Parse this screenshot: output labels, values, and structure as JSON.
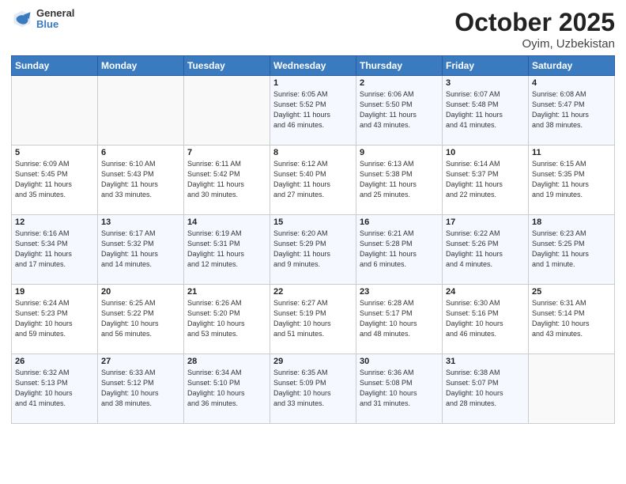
{
  "header": {
    "logo_general": "General",
    "logo_blue": "Blue",
    "month": "October 2025",
    "location": "Oyim, Uzbekistan"
  },
  "weekdays": [
    "Sunday",
    "Monday",
    "Tuesday",
    "Wednesday",
    "Thursday",
    "Friday",
    "Saturday"
  ],
  "weeks": [
    [
      {
        "day": "",
        "info": ""
      },
      {
        "day": "",
        "info": ""
      },
      {
        "day": "",
        "info": ""
      },
      {
        "day": "1",
        "info": "Sunrise: 6:05 AM\nSunset: 5:52 PM\nDaylight: 11 hours\nand 46 minutes."
      },
      {
        "day": "2",
        "info": "Sunrise: 6:06 AM\nSunset: 5:50 PM\nDaylight: 11 hours\nand 43 minutes."
      },
      {
        "day": "3",
        "info": "Sunrise: 6:07 AM\nSunset: 5:48 PM\nDaylight: 11 hours\nand 41 minutes."
      },
      {
        "day": "4",
        "info": "Sunrise: 6:08 AM\nSunset: 5:47 PM\nDaylight: 11 hours\nand 38 minutes."
      }
    ],
    [
      {
        "day": "5",
        "info": "Sunrise: 6:09 AM\nSunset: 5:45 PM\nDaylight: 11 hours\nand 35 minutes."
      },
      {
        "day": "6",
        "info": "Sunrise: 6:10 AM\nSunset: 5:43 PM\nDaylight: 11 hours\nand 33 minutes."
      },
      {
        "day": "7",
        "info": "Sunrise: 6:11 AM\nSunset: 5:42 PM\nDaylight: 11 hours\nand 30 minutes."
      },
      {
        "day": "8",
        "info": "Sunrise: 6:12 AM\nSunset: 5:40 PM\nDaylight: 11 hours\nand 27 minutes."
      },
      {
        "day": "9",
        "info": "Sunrise: 6:13 AM\nSunset: 5:38 PM\nDaylight: 11 hours\nand 25 minutes."
      },
      {
        "day": "10",
        "info": "Sunrise: 6:14 AM\nSunset: 5:37 PM\nDaylight: 11 hours\nand 22 minutes."
      },
      {
        "day": "11",
        "info": "Sunrise: 6:15 AM\nSunset: 5:35 PM\nDaylight: 11 hours\nand 19 minutes."
      }
    ],
    [
      {
        "day": "12",
        "info": "Sunrise: 6:16 AM\nSunset: 5:34 PM\nDaylight: 11 hours\nand 17 minutes."
      },
      {
        "day": "13",
        "info": "Sunrise: 6:17 AM\nSunset: 5:32 PM\nDaylight: 11 hours\nand 14 minutes."
      },
      {
        "day": "14",
        "info": "Sunrise: 6:19 AM\nSunset: 5:31 PM\nDaylight: 11 hours\nand 12 minutes."
      },
      {
        "day": "15",
        "info": "Sunrise: 6:20 AM\nSunset: 5:29 PM\nDaylight: 11 hours\nand 9 minutes."
      },
      {
        "day": "16",
        "info": "Sunrise: 6:21 AM\nSunset: 5:28 PM\nDaylight: 11 hours\nand 6 minutes."
      },
      {
        "day": "17",
        "info": "Sunrise: 6:22 AM\nSunset: 5:26 PM\nDaylight: 11 hours\nand 4 minutes."
      },
      {
        "day": "18",
        "info": "Sunrise: 6:23 AM\nSunset: 5:25 PM\nDaylight: 11 hours\nand 1 minute."
      }
    ],
    [
      {
        "day": "19",
        "info": "Sunrise: 6:24 AM\nSunset: 5:23 PM\nDaylight: 10 hours\nand 59 minutes."
      },
      {
        "day": "20",
        "info": "Sunrise: 6:25 AM\nSunset: 5:22 PM\nDaylight: 10 hours\nand 56 minutes."
      },
      {
        "day": "21",
        "info": "Sunrise: 6:26 AM\nSunset: 5:20 PM\nDaylight: 10 hours\nand 53 minutes."
      },
      {
        "day": "22",
        "info": "Sunrise: 6:27 AM\nSunset: 5:19 PM\nDaylight: 10 hours\nand 51 minutes."
      },
      {
        "day": "23",
        "info": "Sunrise: 6:28 AM\nSunset: 5:17 PM\nDaylight: 10 hours\nand 48 minutes."
      },
      {
        "day": "24",
        "info": "Sunrise: 6:30 AM\nSunset: 5:16 PM\nDaylight: 10 hours\nand 46 minutes."
      },
      {
        "day": "25",
        "info": "Sunrise: 6:31 AM\nSunset: 5:14 PM\nDaylight: 10 hours\nand 43 minutes."
      }
    ],
    [
      {
        "day": "26",
        "info": "Sunrise: 6:32 AM\nSunset: 5:13 PM\nDaylight: 10 hours\nand 41 minutes."
      },
      {
        "day": "27",
        "info": "Sunrise: 6:33 AM\nSunset: 5:12 PM\nDaylight: 10 hours\nand 38 minutes."
      },
      {
        "day": "28",
        "info": "Sunrise: 6:34 AM\nSunset: 5:10 PM\nDaylight: 10 hours\nand 36 minutes."
      },
      {
        "day": "29",
        "info": "Sunrise: 6:35 AM\nSunset: 5:09 PM\nDaylight: 10 hours\nand 33 minutes."
      },
      {
        "day": "30",
        "info": "Sunrise: 6:36 AM\nSunset: 5:08 PM\nDaylight: 10 hours\nand 31 minutes."
      },
      {
        "day": "31",
        "info": "Sunrise: 6:38 AM\nSunset: 5:07 PM\nDaylight: 10 hours\nand 28 minutes."
      },
      {
        "day": "",
        "info": ""
      }
    ]
  ]
}
